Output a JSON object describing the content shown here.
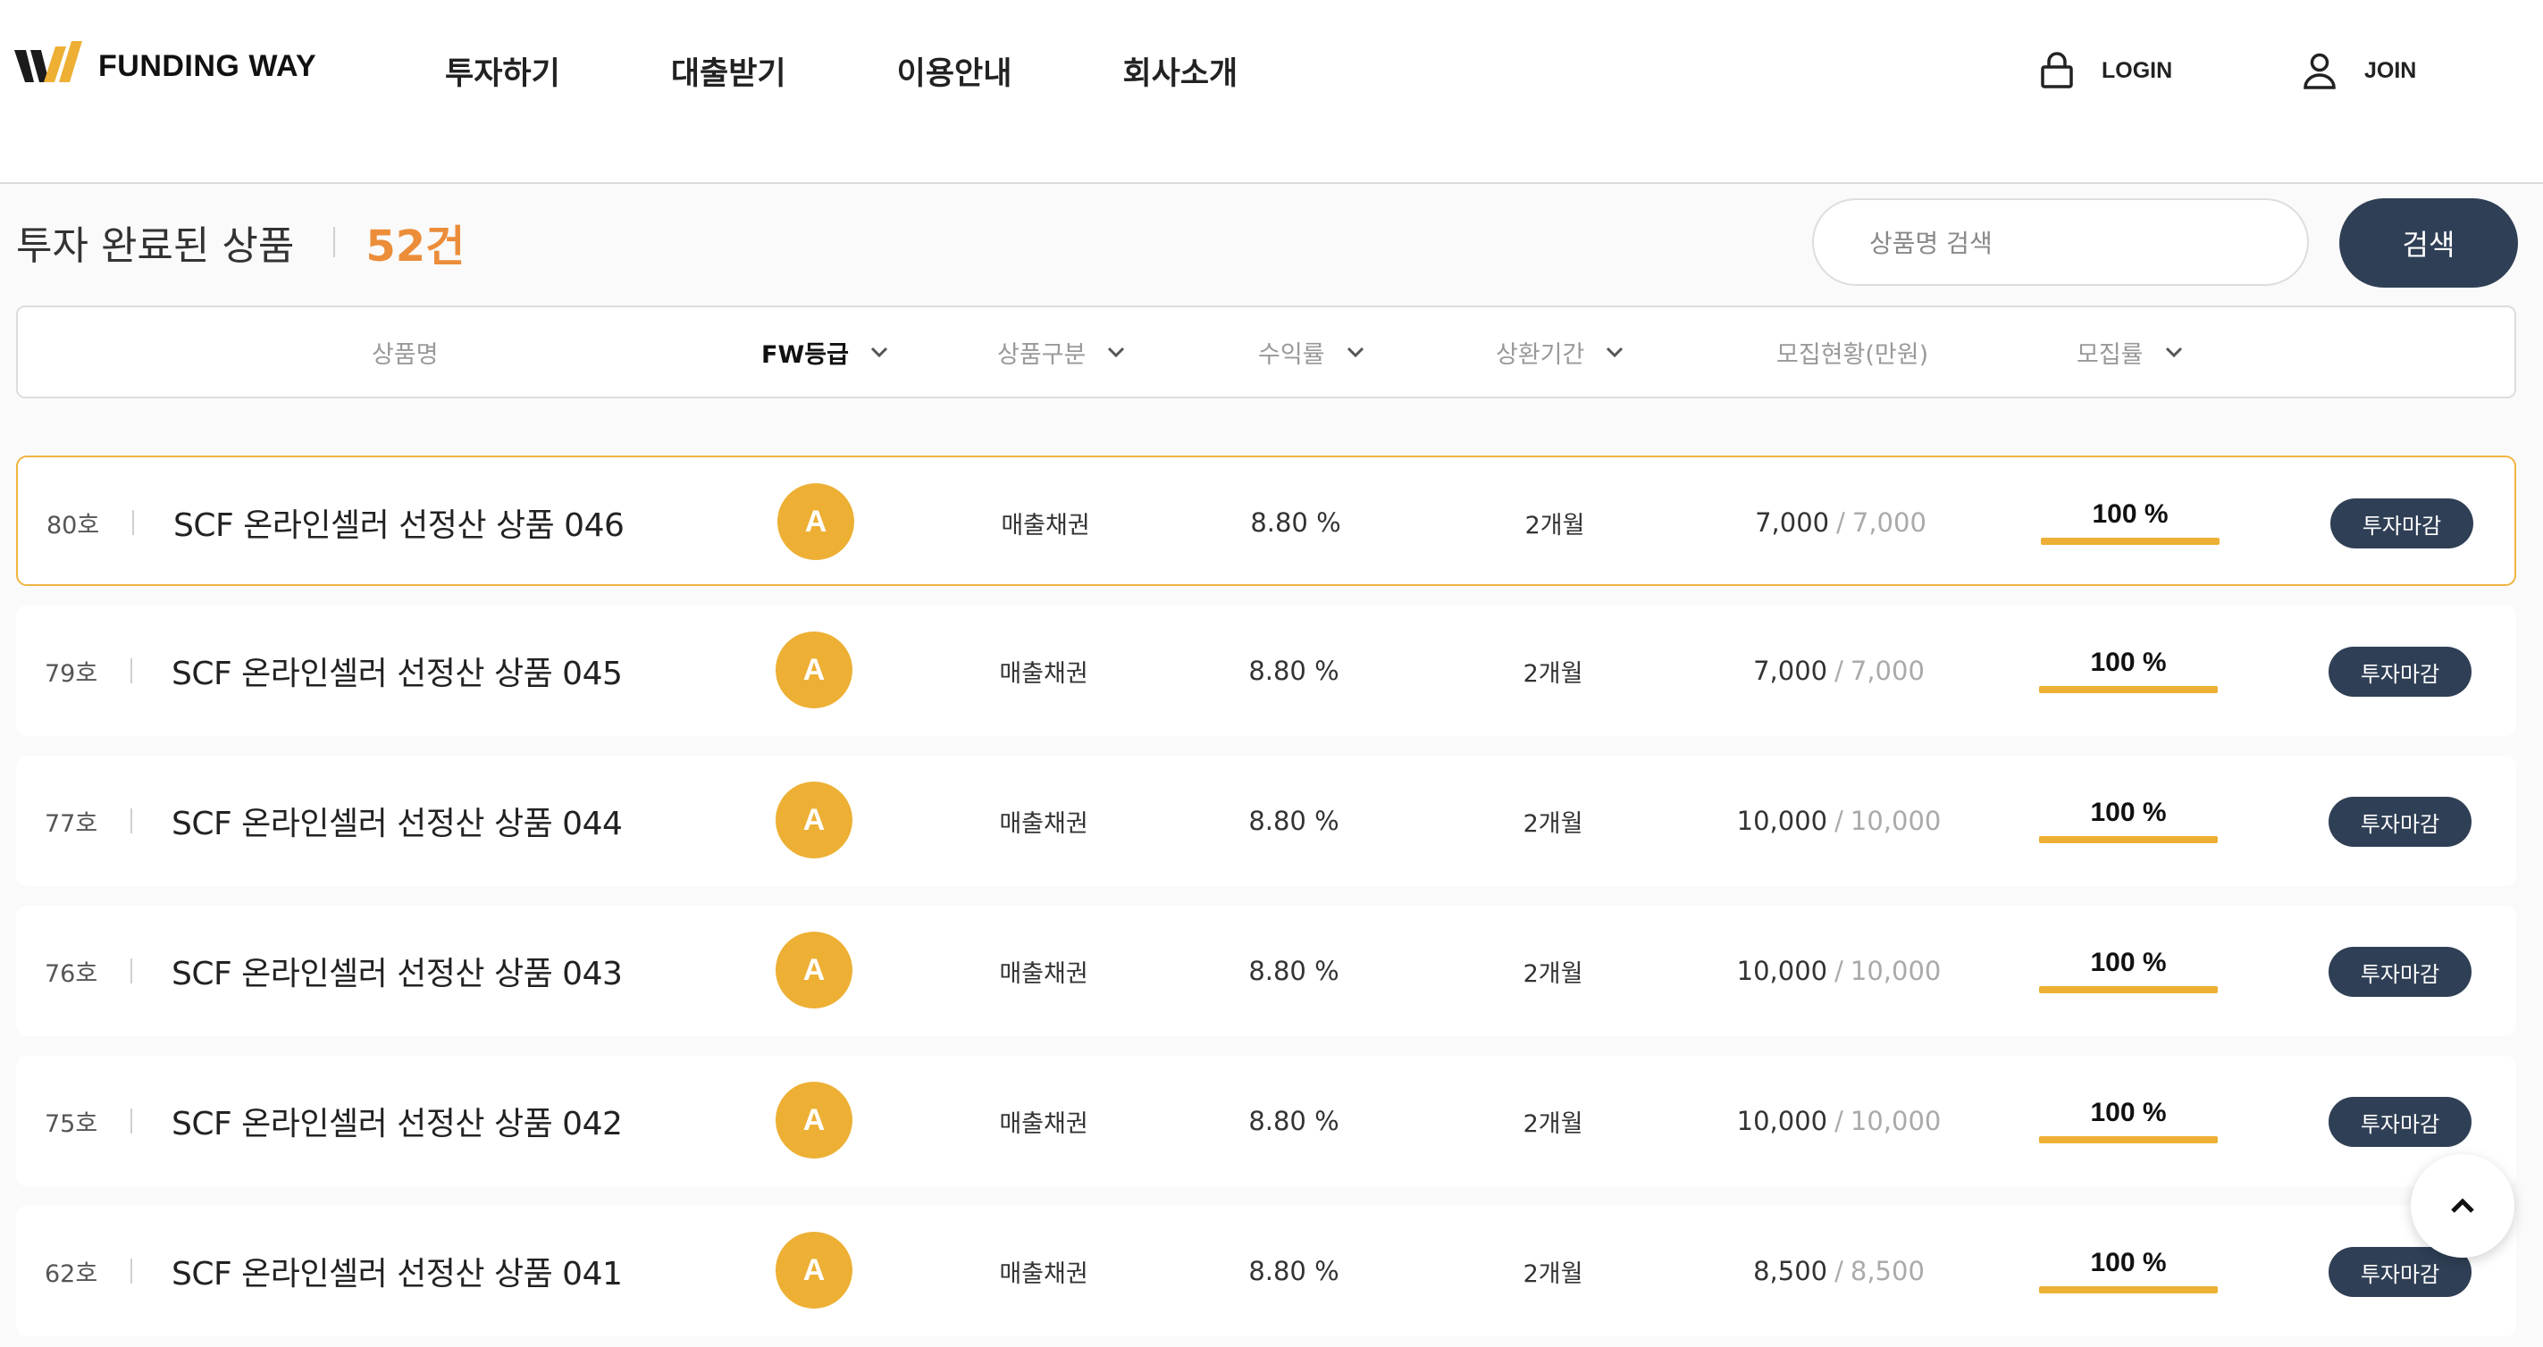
{
  "brand": {
    "name": "FUNDING WAY",
    "colors": {
      "accent": "#edb035",
      "navy": "#2f3f55",
      "count": "#ec8d3a"
    }
  },
  "nav": {
    "items": [
      "투자하기",
      "대출받기",
      "이용안내",
      "회사소개"
    ]
  },
  "auth": {
    "login": "LOGIN",
    "join": "JOIN",
    "login_icon": "lock-icon",
    "join_icon": "user-icon"
  },
  "listing": {
    "title": "투자 완료된 상품",
    "count": "52건",
    "search_placeholder": "상품명 검색",
    "search_button": "검색"
  },
  "columns": {
    "name": "상품명",
    "grade": "FW등급",
    "type": "상품구분",
    "rate": "수익률",
    "term": "상환기간",
    "amount": "모집현황(만원)",
    "progress": "모집률"
  },
  "rows": [
    {
      "no": "80호",
      "name": "SCF 온라인셀러 선정산 상품 046",
      "grade": "A",
      "type": "매출채권",
      "rate": "8.80 %",
      "term": "2개월",
      "raised": "7,000",
      "goal": "7,000",
      "percent": "100 %",
      "progress": 1.0,
      "status": "투자마감"
    },
    {
      "no": "79호",
      "name": "SCF 온라인셀러 선정산 상품 045",
      "grade": "A",
      "type": "매출채권",
      "rate": "8.80 %",
      "term": "2개월",
      "raised": "7,000",
      "goal": "7,000",
      "percent": "100 %",
      "progress": 1.0,
      "status": "투자마감"
    },
    {
      "no": "77호",
      "name": "SCF 온라인셀러 선정산 상품 044",
      "grade": "A",
      "type": "매출채권",
      "rate": "8.80 %",
      "term": "2개월",
      "raised": "10,000",
      "goal": "10,000",
      "percent": "100 %",
      "progress": 1.0,
      "status": "투자마감"
    },
    {
      "no": "76호",
      "name": "SCF 온라인셀러 선정산 상품 043",
      "grade": "A",
      "type": "매출채권",
      "rate": "8.80 %",
      "term": "2개월",
      "raised": "10,000",
      "goal": "10,000",
      "percent": "100 %",
      "progress": 1.0,
      "status": "투자마감"
    },
    {
      "no": "75호",
      "name": "SCF 온라인셀러 선정산 상품 042",
      "grade": "A",
      "type": "매출채권",
      "rate": "8.80 %",
      "term": "2개월",
      "raised": "10,000",
      "goal": "10,000",
      "percent": "100 %",
      "progress": 1.0,
      "status": "투자마감"
    },
    {
      "no": "62호",
      "name": "SCF 온라인셀러 선정산 상품 041",
      "grade": "A",
      "type": "매출채권",
      "rate": "8.80 %",
      "term": "2개월",
      "raised": "8,500",
      "goal": "8,500",
      "percent": "100 %",
      "progress": 1.0,
      "status": "투자마감"
    }
  ]
}
